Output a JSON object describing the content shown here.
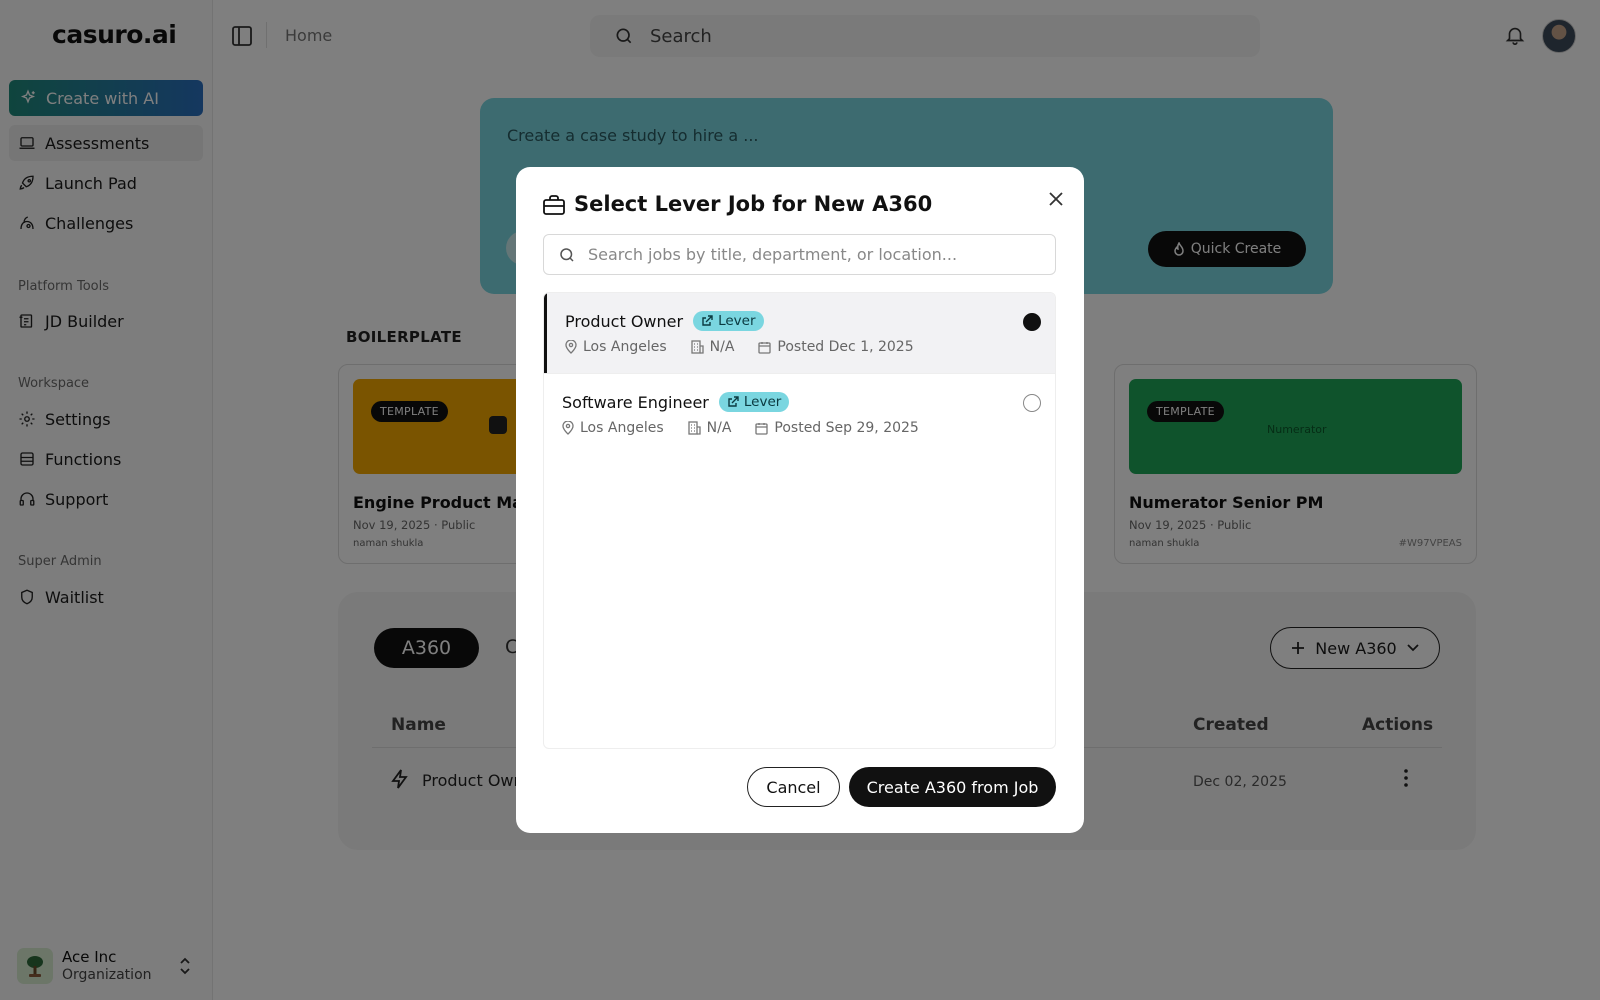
{
  "app": {
    "logo": "casuro.ai"
  },
  "sidebar": {
    "create_ai": "Create with AI",
    "items": [
      {
        "label": "Assessments"
      },
      {
        "label": "Launch Pad"
      },
      {
        "label": "Challenges"
      }
    ],
    "platform_tools": {
      "heading": "Platform Tools",
      "items": [
        {
          "label": "JD Builder"
        }
      ]
    },
    "workspace": {
      "heading": "Workspace",
      "items": [
        {
          "label": "Settings"
        },
        {
          "label": "Functions"
        },
        {
          "label": "Support"
        }
      ]
    },
    "super_admin": {
      "heading": "Super Admin",
      "items": [
        {
          "label": "Waitlist"
        }
      ]
    },
    "org": {
      "name": "Ace Inc",
      "type": "Organization"
    }
  },
  "topbar": {
    "breadcrumb": "Home",
    "search_placeholder": "Search"
  },
  "hero": {
    "placeholder": "Create a case study to hire a ...",
    "quick_create": "Quick Create"
  },
  "boilerplate": {
    "heading": "BOILERPLATE",
    "cards": [
      {
        "badge": "TEMPLATE",
        "title": "Engine Product Manc",
        "meta": "Nov 19, 2025 · Public",
        "author": "naman shukla",
        "banner_color": "#f5a800"
      },
      {
        "badge": "TEMPLATE",
        "title": "Numerator Senior PM",
        "meta": "Nov 19, 2025 · Public",
        "author": "naman shukla",
        "code": "#W97VPEAS",
        "logo_text": "Numerator",
        "banner_color": "#1fa659"
      }
    ]
  },
  "a360": {
    "active_tab": "A360",
    "other_tab": "C",
    "new_button": "New A360",
    "columns": {
      "name": "Name",
      "created": "Created",
      "actions": "Actions"
    },
    "rows": [
      {
        "name": "Product Own",
        "created": "Dec 02, 2025"
      }
    ]
  },
  "modal": {
    "title": "Select Lever Job for New A360",
    "search_placeholder": "Search jobs by title, department, or location...",
    "jobs": [
      {
        "title": "Product Owner",
        "badge": "Lever",
        "location": "Los Angeles",
        "department": "N/A",
        "posted": "Posted Dec 1, 2025",
        "selected": true
      },
      {
        "title": "Software Engineer",
        "badge": "Lever",
        "location": "Los Angeles",
        "department": "N/A",
        "posted": "Posted Sep 29, 2025",
        "selected": false
      }
    ],
    "cancel": "Cancel",
    "confirm": "Create A360 from Job"
  },
  "colors": {
    "accent_teal": "#7ad6e0",
    "primary_dark": "#111111",
    "overlay": "rgba(0,0,0,0.5)"
  }
}
